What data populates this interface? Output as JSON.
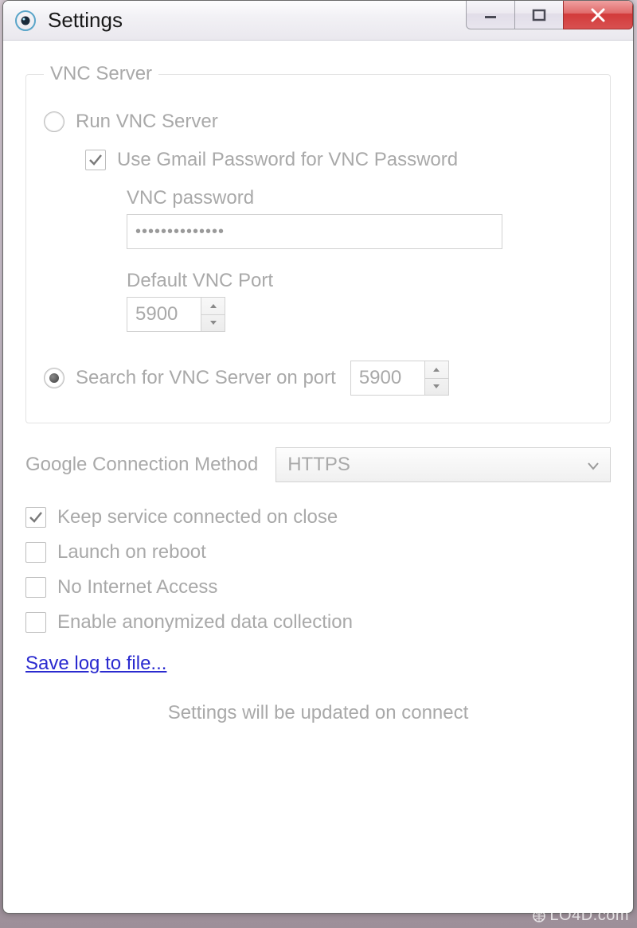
{
  "window": {
    "title": "Settings"
  },
  "group": {
    "legend": "VNC Server",
    "radio_run_label": "Run VNC Server",
    "use_gmail_label": "Use Gmail Password for VNC Password",
    "vnc_password_label": "VNC password",
    "vnc_password_value": "••••••••••••••",
    "default_port_label": "Default VNC Port",
    "default_port_value": "5900",
    "radio_search_label": "Search for VNC Server on port",
    "search_port_value": "5900"
  },
  "connection": {
    "label": "Google Connection Method",
    "selected": "HTTPS"
  },
  "options": {
    "keep_connected": "Keep service connected on close",
    "launch_reboot": "Launch on reboot",
    "no_internet": "No Internet Access",
    "anon_data": "Enable anonymized data collection"
  },
  "link": {
    "save_log": "Save log to file..."
  },
  "footer": {
    "note": "Settings will be updated on connect"
  },
  "watermark": "LO4D.com"
}
